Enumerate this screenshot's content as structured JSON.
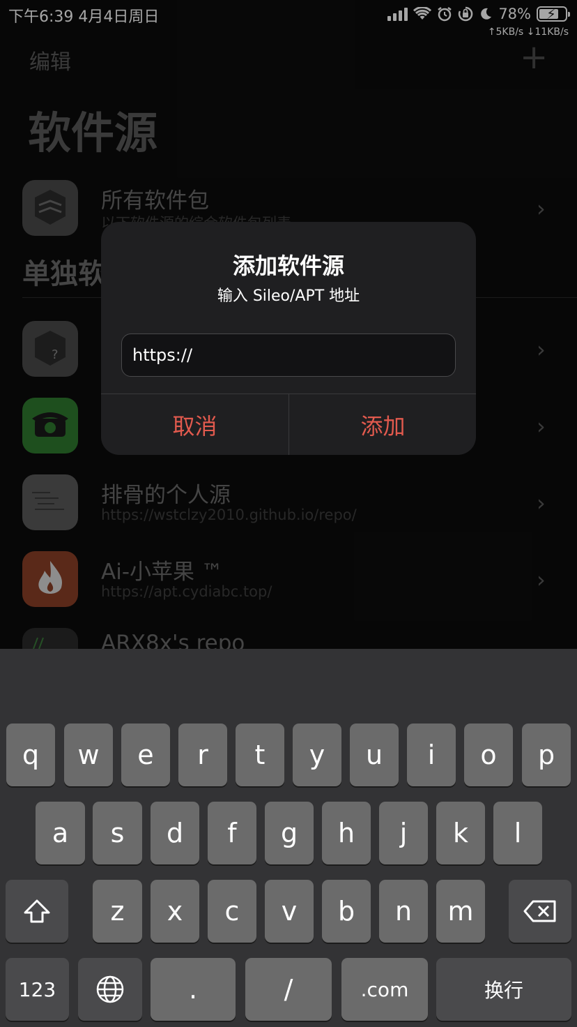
{
  "status": {
    "time": "下午6:39   4月4日周日",
    "battery": "78%",
    "battery_level": 0.78,
    "speed": "↑5KB/s ↓11KB/s"
  },
  "nav": {
    "edit_label": "编辑",
    "add_icon": "plus-icon"
  },
  "page": {
    "title": "软件源",
    "section": "单独软"
  },
  "rows": [
    {
      "title": "所有软件包",
      "subtitle": "以下软件源的综合软件包列表"
    },
    {
      "title": "",
      "subtitle": ""
    },
    {
      "title": "",
      "subtitle": ""
    },
    {
      "title": "排骨的个人源",
      "subtitle": "https://wstclzy2010.github.io/repo/"
    },
    {
      "title": "Ai-小苹果 ™",
      "subtitle": "https://apt.cydiabc.top/"
    },
    {
      "title": "ARX8x's repo",
      "subtitle": ""
    }
  ],
  "alert": {
    "title": "添加软件源",
    "message": "输入 Sileo/APT 地址",
    "input_value": "https://",
    "cancel_label": "取消",
    "add_label": "添加",
    "accent_color": "#e25a4e"
  },
  "keyboard": {
    "row1": [
      "q",
      "w",
      "e",
      "r",
      "t",
      "y",
      "u",
      "i",
      "o",
      "p"
    ],
    "row2": [
      "a",
      "s",
      "d",
      "f",
      "g",
      "h",
      "j",
      "k",
      "l"
    ],
    "row3": [
      "z",
      "x",
      "c",
      "v",
      "b",
      "n",
      "m"
    ],
    "numbers_label": "123",
    "dot_label": ".",
    "slash_label": "/",
    "com_label": ".com",
    "return_label": "换行"
  }
}
